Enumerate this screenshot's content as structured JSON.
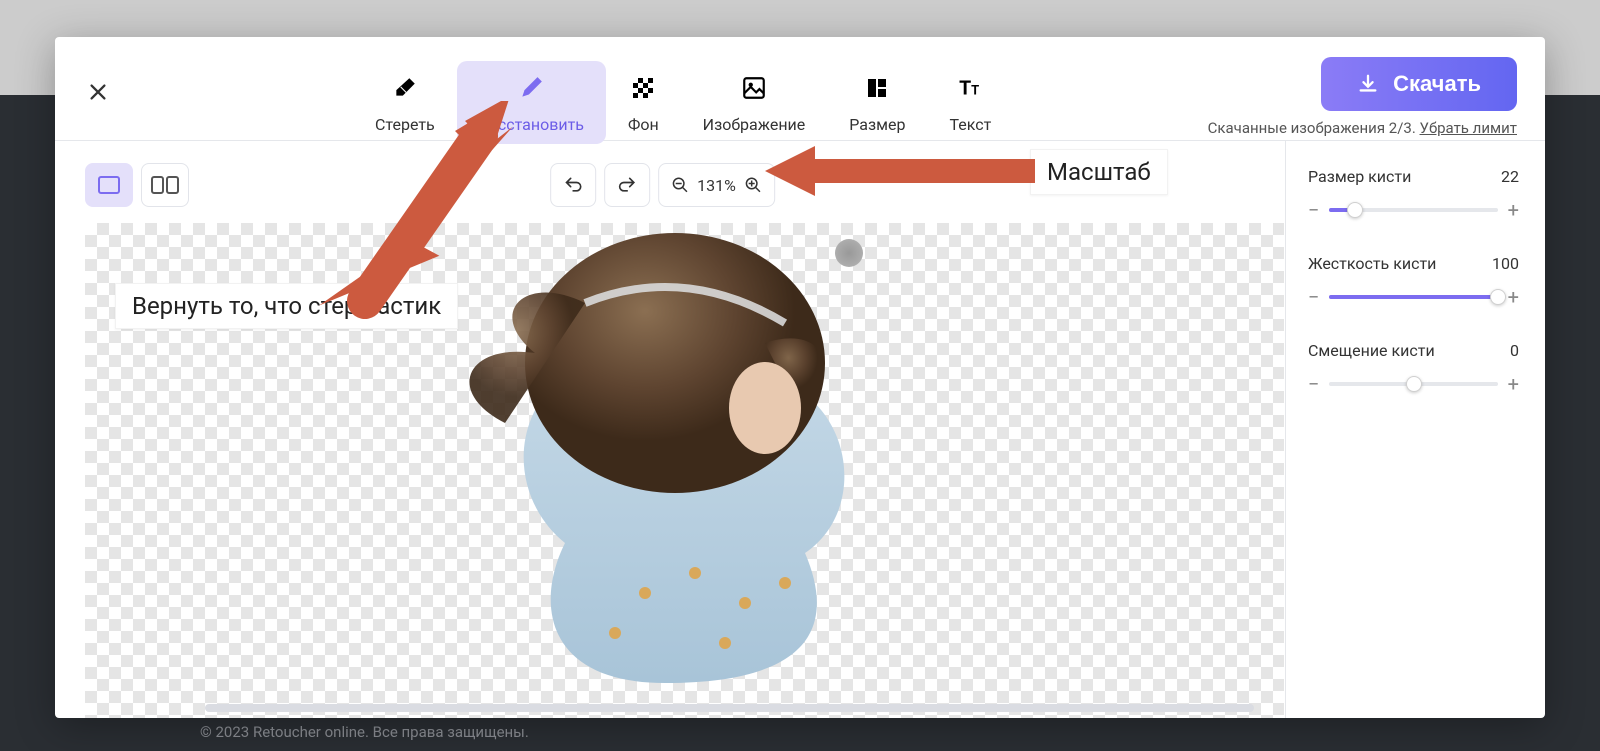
{
  "toolbar": {
    "tools": [
      {
        "label": "Стереть"
      },
      {
        "label": "Восстановить"
      },
      {
        "label": "Фон"
      },
      {
        "label": "Изображение"
      },
      {
        "label": "Размер"
      },
      {
        "label": "Текст"
      }
    ],
    "download_label": "Скачать",
    "downloads_text": "Скачанные изображения 2/3.",
    "remove_limit": "Убрать лимит"
  },
  "zoom": {
    "value": "131%"
  },
  "annotations": {
    "restore": "Вернуть то, что стер ластик",
    "scale": "Масштаб"
  },
  "sidebar": {
    "brush_size": {
      "label": "Размер кисти",
      "value": "22",
      "fill_pct": 15
    },
    "hardness": {
      "label": "Жесткость кисти",
      "value": "100",
      "fill_pct": 100
    },
    "offset": {
      "label": "Смещение кисти",
      "value": "0",
      "fill_pct": 50
    }
  },
  "footer": "© 2023 Retoucher online. Все права защищены."
}
